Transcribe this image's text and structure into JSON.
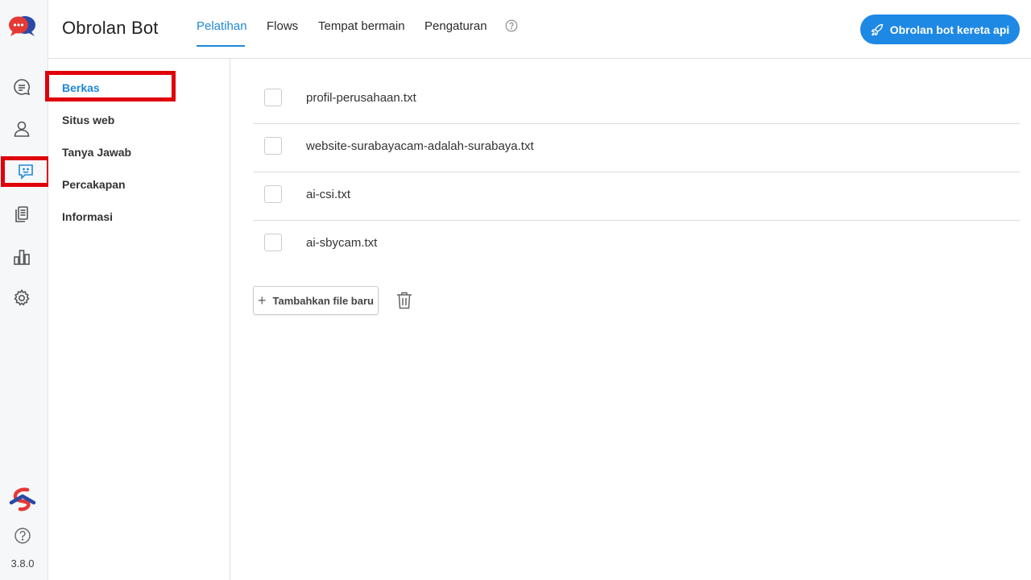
{
  "header": {
    "app_title": "Obrolan Bot",
    "tabs": [
      {
        "label": "Pelatihan",
        "active": true
      },
      {
        "label": "Flows",
        "active": false
      },
      {
        "label": "Tempat bermain",
        "active": false
      },
      {
        "label": "Pengaturan",
        "active": false
      }
    ],
    "cta_label": "Obrolan bot kereta api"
  },
  "rail": {
    "icons": [
      "chat-bubble-icon",
      "user-icon",
      "bot-message-icon",
      "documents-icon",
      "bar-chart-icon",
      "gear-icon"
    ],
    "active_icon": "bot-message-icon",
    "version": "3.8.0"
  },
  "subnav": {
    "items": [
      {
        "label": "Berkas",
        "active": true
      },
      {
        "label": "Situs web",
        "active": false
      },
      {
        "label": "Tanya Jawab",
        "active": false
      },
      {
        "label": "Percakapan",
        "active": false
      },
      {
        "label": "Informasi",
        "active": false
      }
    ]
  },
  "files": {
    "items": [
      {
        "name": "profil-perusahaan.txt"
      },
      {
        "name": "website-surabayacam-adalah-surabaya.txt"
      },
      {
        "name": "ai-csi.txt"
      },
      {
        "name": "ai-sbycam.txt"
      }
    ],
    "add_label": "Tambahkan file baru"
  },
  "colors": {
    "accent": "#1e88e5",
    "highlight": "#e0000b"
  }
}
